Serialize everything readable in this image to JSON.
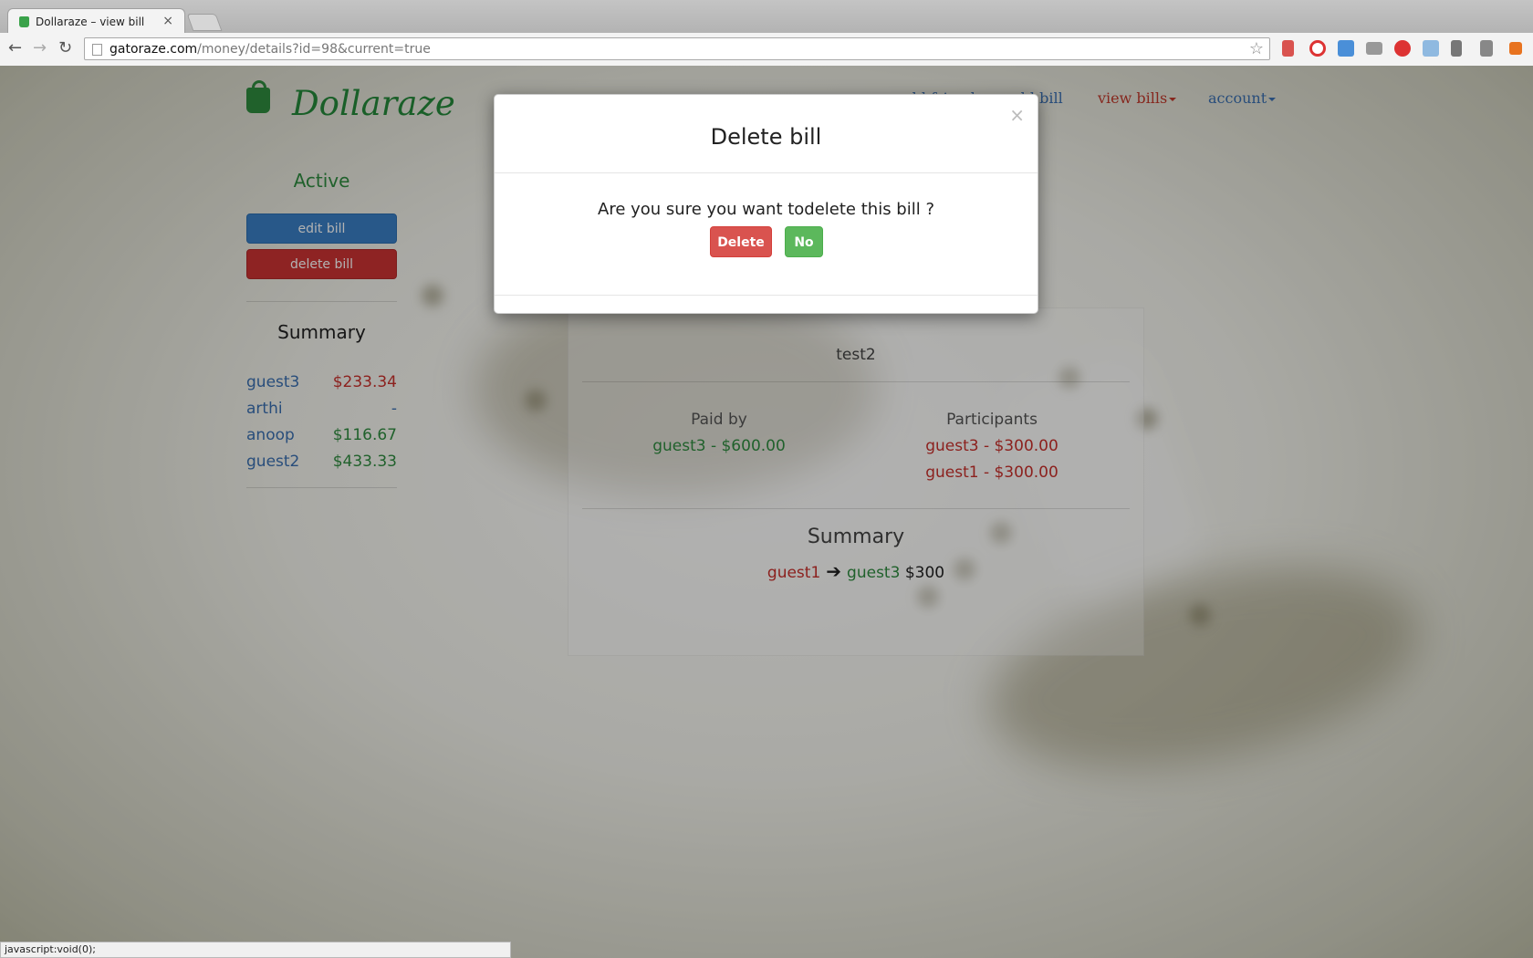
{
  "browser": {
    "tab_title": "Dollaraze – view bill",
    "tab_close": "×",
    "url_host": "gatoraze.com",
    "url_path": "/money/details?id=98&current=true",
    "status_text": "javascript:void(0);"
  },
  "site": {
    "logo_text": "Dollaraze",
    "nav": {
      "add_friends": "add friends",
      "add_bill": "add bill",
      "view_bills": "view bills",
      "account": "account"
    }
  },
  "sidebar": {
    "status": "Active",
    "edit_button": "edit bill",
    "delete_button": "delete bill",
    "summary_title": "Summary",
    "summary": [
      {
        "name": "guest3",
        "amount": "$233.34",
        "color": "#c9302c"
      },
      {
        "name": "arthi",
        "amount": "-",
        "color": "#3a6fb0"
      },
      {
        "name": "anoop",
        "amount": "$116.67",
        "color": "#2f8c3f"
      },
      {
        "name": "guest2",
        "amount": "$433.33",
        "color": "#2f8c3f"
      }
    ]
  },
  "bill": {
    "name": "test2",
    "paid_by_label": "Paid by",
    "paid_by": [
      "guest3 - $600.00"
    ],
    "participants_label": "Participants",
    "participants": [
      "guest3 - $300.00",
      "guest1 - $300.00"
    ],
    "summary_title": "Summary",
    "settlement": {
      "from": "guest1",
      "arrow": "➔",
      "to": "guest3",
      "amount": "$300"
    }
  },
  "modal": {
    "title": "Delete bill",
    "close": "×",
    "message": "Are you sure you want todelete this bill ?",
    "delete_label": "Delete",
    "no_label": "No"
  },
  "colors": {
    "brand_green": "#25883a",
    "danger": "#d9534f",
    "success": "#5cb85c",
    "primary": "#3a7fc4"
  }
}
